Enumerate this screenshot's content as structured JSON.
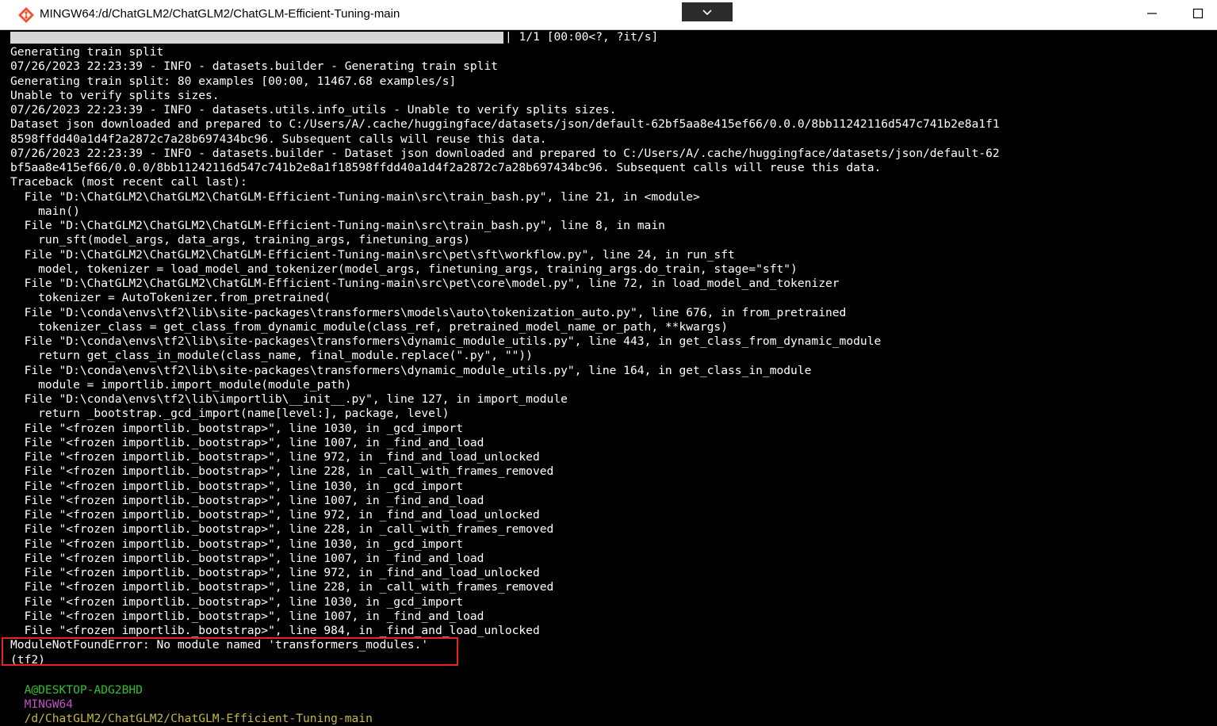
{
  "window": {
    "title": "MINGW64:/d/ChatGLM2/ChatGLM2/ChatGLM-Efficient-Tuning-main",
    "minimize_label": "—",
    "maximize_label": "☐"
  },
  "progress": {
    "fraction": 1.0,
    "text": "| 1/1 [00:00<?, ?it/s]"
  },
  "lines": [
    "Generating train split",
    "07/26/2023 22:23:39 - INFO - datasets.builder - Generating train split",
    "Generating train split: 80 examples [00:00, 11467.68 examples/s]",
    "Unable to verify splits sizes.",
    "07/26/2023 22:23:39 - INFO - datasets.utils.info_utils - Unable to verify splits sizes.",
    "Dataset json downloaded and prepared to C:/Users/A/.cache/huggingface/datasets/json/default-62bf5aa8e415ef66/0.0.0/8bb11242116d547c741b2e8a1f1",
    "8598ffdd40a1d4f2a2872c7a28b697434bc96. Subsequent calls will reuse this data.",
    "07/26/2023 22:23:39 - INFO - datasets.builder - Dataset json downloaded and prepared to C:/Users/A/.cache/huggingface/datasets/json/default-62",
    "bf5aa8e415ef66/0.0.0/8bb11242116d547c741b2e8a1f18598ffdd40a1d4f2a2872c7a28b697434bc96. Subsequent calls will reuse this data.",
    "Traceback (most recent call last):",
    "  File \"D:\\ChatGLM2\\ChatGLM2\\ChatGLM-Efficient-Tuning-main\\src\\train_bash.py\", line 21, in <module>",
    "    main()",
    "  File \"D:\\ChatGLM2\\ChatGLM2\\ChatGLM-Efficient-Tuning-main\\src\\train_bash.py\", line 8, in main",
    "    run_sft(model_args, data_args, training_args, finetuning_args)",
    "  File \"D:\\ChatGLM2\\ChatGLM2\\ChatGLM-Efficient-Tuning-main\\src\\pet\\sft\\workflow.py\", line 24, in run_sft",
    "    model, tokenizer = load_model_and_tokenizer(model_args, finetuning_args, training_args.do_train, stage=\"sft\")",
    "  File \"D:\\ChatGLM2\\ChatGLM2\\ChatGLM-Efficient-Tuning-main\\src\\pet\\core\\model.py\", line 72, in load_model_and_tokenizer",
    "    tokenizer = AutoTokenizer.from_pretrained(",
    "  File \"D:\\conda\\envs\\tf2\\lib\\site-packages\\transformers\\models\\auto\\tokenization_auto.py\", line 676, in from_pretrained",
    "    tokenizer_class = get_class_from_dynamic_module(class_ref, pretrained_model_name_or_path, **kwargs)",
    "  File \"D:\\conda\\envs\\tf2\\lib\\site-packages\\transformers\\dynamic_module_utils.py\", line 443, in get_class_from_dynamic_module",
    "    return get_class_in_module(class_name, final_module.replace(\".py\", \"\"))",
    "  File \"D:\\conda\\envs\\tf2\\lib\\site-packages\\transformers\\dynamic_module_utils.py\", line 164, in get_class_in_module",
    "    module = importlib.import_module(module_path)",
    "  File \"D:\\conda\\envs\\tf2\\lib\\importlib\\__init__.py\", line 127, in import_module",
    "    return _bootstrap._gcd_import(name[level:], package, level)",
    "  File \"<frozen importlib._bootstrap>\", line 1030, in _gcd_import",
    "  File \"<frozen importlib._bootstrap>\", line 1007, in _find_and_load",
    "  File \"<frozen importlib._bootstrap>\", line 972, in _find_and_load_unlocked",
    "  File \"<frozen importlib._bootstrap>\", line 228, in _call_with_frames_removed",
    "  File \"<frozen importlib._bootstrap>\", line 1030, in _gcd_import",
    "  File \"<frozen importlib._bootstrap>\", line 1007, in _find_and_load",
    "  File \"<frozen importlib._bootstrap>\", line 972, in _find_and_load_unlocked",
    "  File \"<frozen importlib._bootstrap>\", line 228, in _call_with_frames_removed",
    "  File \"<frozen importlib._bootstrap>\", line 1030, in _gcd_import",
    "  File \"<frozen importlib._bootstrap>\", line 1007, in _find_and_load",
    "  File \"<frozen importlib._bootstrap>\", line 972, in _find_and_load_unlocked",
    "  File \"<frozen importlib._bootstrap>\", line 228, in _call_with_frames_removed",
    "  File \"<frozen importlib._bootstrap>\", line 1030, in _gcd_import",
    "  File \"<frozen importlib._bootstrap>\", line 1007, in _find_and_load",
    "  File \"<frozen importlib._bootstrap>\", line 984, in _find_and_load_unlocked",
    "ModuleNotFoundError: No module named 'transformers_modules.'",
    "(tf2)"
  ],
  "prompt": {
    "user": "A@DESKTOP-ADG2BHD",
    "system": "MINGW64",
    "path": "/d/ChatGLM2/ChatGLM2/ChatGLM-Efficient-Tuning-main"
  },
  "colors": {
    "error_highlight": "#e8231f",
    "prompt_user": "#2fc12f",
    "prompt_system": "#c64ec6",
    "prompt_path": "#c9b73a"
  },
  "icons": {
    "app": "git-bash-icon",
    "dropdown": "chevron-down-icon"
  }
}
